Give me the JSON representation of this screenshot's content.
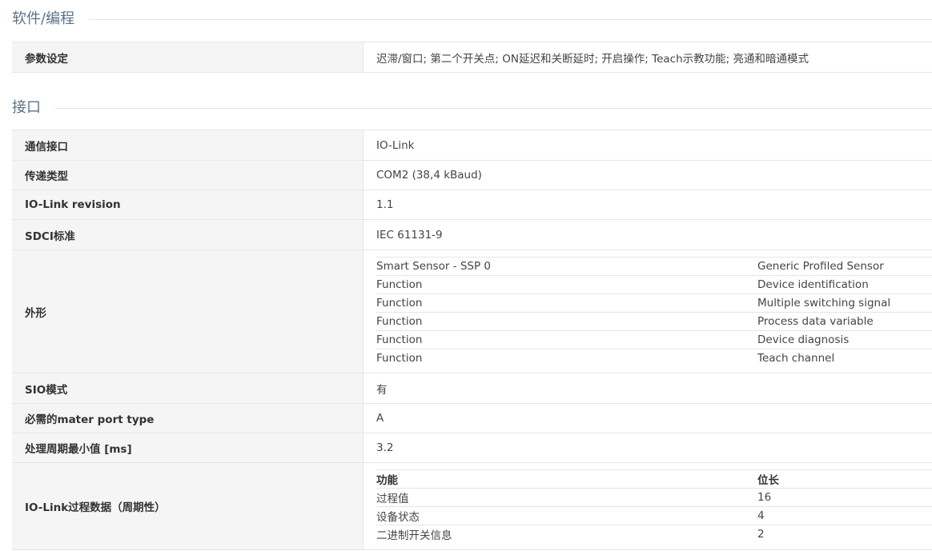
{
  "sections": {
    "software": {
      "title": "软件/编程",
      "rows": [
        {
          "label": "参数设定",
          "value": "迟滞/窗口; 第二个开关点; ON延迟和关断延时; 开启操作; Teach示教功能; 亮通和暗通模式"
        }
      ]
    },
    "interface": {
      "title": "接口",
      "comm_interface": {
        "label": "通信接口",
        "value": "IO-Link"
      },
      "transmission_type": {
        "label": "传递类型",
        "value": "COM2 (38,4 kBaud)"
      },
      "iolink_revision": {
        "label": "IO-Link revision",
        "value": "1.1"
      },
      "sdci_standard": {
        "label": "SDCI标准",
        "value": "IEC 61131-9"
      },
      "profile": {
        "label": "外形",
        "rows": [
          {
            "left": "Smart Sensor - SSP 0",
            "right": "Generic Profiled Sensor"
          },
          {
            "left": "Function",
            "right": "Device identification"
          },
          {
            "left": "Function",
            "right": "Multiple switching signal"
          },
          {
            "left": "Function",
            "right": "Process data variable"
          },
          {
            "left": "Function",
            "right": "Device diagnosis"
          },
          {
            "left": "Function",
            "right": "Teach channel"
          }
        ]
      },
      "sio_mode": {
        "label": "SIO模式",
        "value": "有"
      },
      "master_port_type": {
        "label": "必需的mater port type",
        "value": "A"
      },
      "min_cycle_time": {
        "label": "处理周期最小值 [ms]",
        "value": "3.2"
      },
      "process_data": {
        "label": "IO-Link过程数据（周期性）",
        "header": {
          "col1": "功能",
          "col2": "位长"
        },
        "rows": [
          {
            "function": "过程值",
            "bits": "16"
          },
          {
            "function": "设备状态",
            "bits": "4"
          },
          {
            "function": "二进制开关信息",
            "bits": "2"
          }
        ]
      }
    }
  }
}
